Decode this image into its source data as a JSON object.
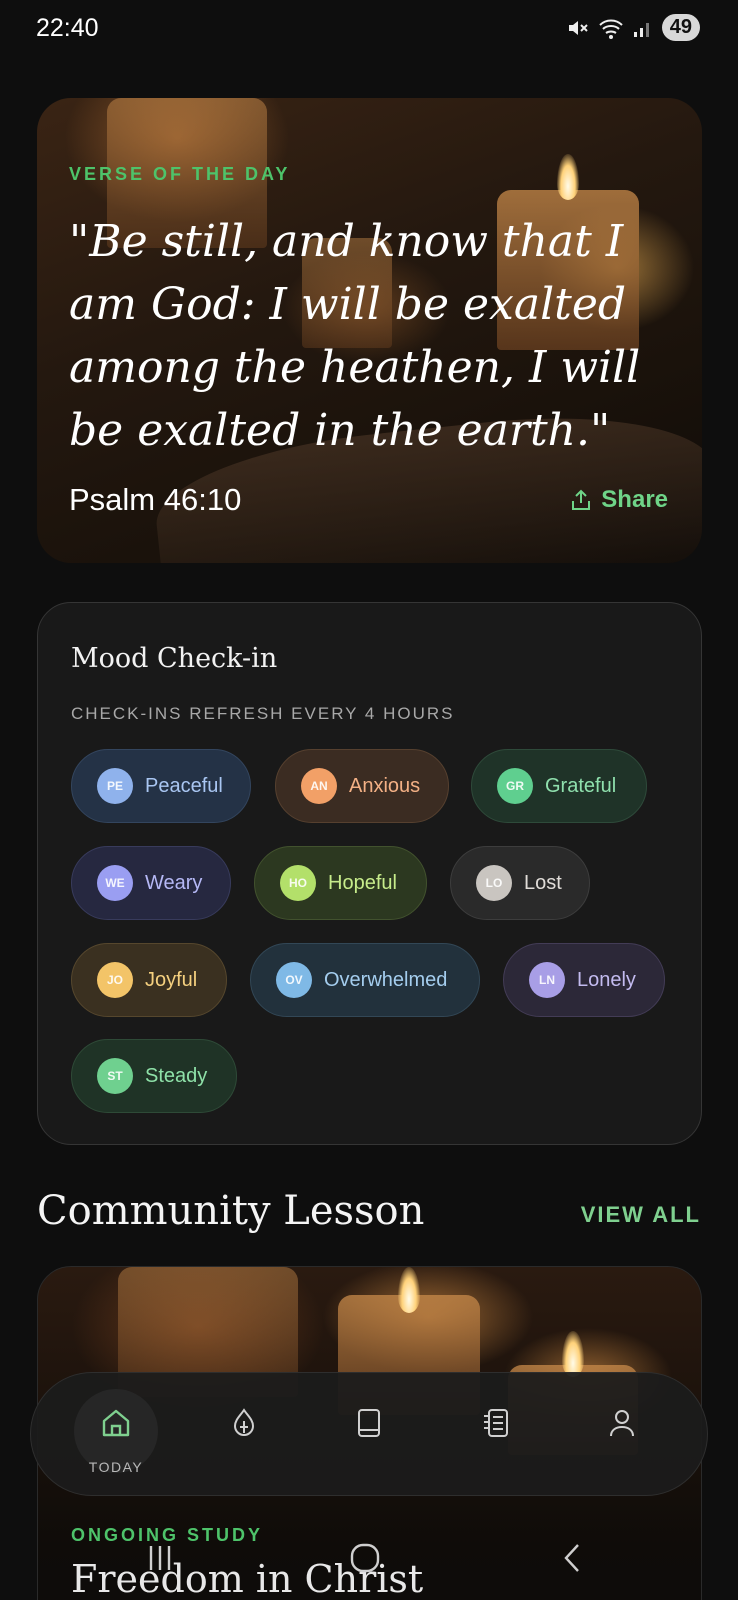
{
  "status_bar": {
    "time": "22:40",
    "battery": "49"
  },
  "verse": {
    "label": "VERSE OF THE DAY",
    "text": "\"Be still, and know that I am God: I will be exalted among the heathen, I will be exalted in the earth.\"",
    "reference": "Psalm 46:10",
    "share_label": "Share"
  },
  "mood": {
    "title": "Mood Check-in",
    "subtitle": "CHECK-INS REFRESH EVERY 4 HOURS",
    "chips": [
      {
        "initials": "PE",
        "label": "Peaceful",
        "bg": "#243246",
        "border": "#33455e",
        "av": "#8fb2ec",
        "text": "#a9c6f2"
      },
      {
        "initials": "AN",
        "label": "Anxious",
        "bg": "#3b2c22",
        "border": "#56402f",
        "av": "#f2a067",
        "text": "#f3b085"
      },
      {
        "initials": "GR",
        "label": "Grateful",
        "bg": "#1f3328",
        "border": "#2e4a3a",
        "av": "#5fcf8f",
        "text": "#8fe0ad"
      },
      {
        "initials": "WE",
        "label": "Weary",
        "bg": "#262840",
        "border": "#383b5c",
        "av": "#9a9ef2",
        "text": "#b5b8f5"
      },
      {
        "initials": "HO",
        "label": "Hopeful",
        "bg": "#2c3820",
        "border": "#42522e",
        "av": "#b3e06a",
        "text": "#c7ec8b"
      },
      {
        "initials": "LO",
        "label": "Lost",
        "bg": "#2a2a2a",
        "border": "#3d3d3d",
        "av": "#c9c5c0",
        "text": "#e0dcd8"
      },
      {
        "initials": "JO",
        "label": "Joyful",
        "bg": "#3a3020",
        "border": "#56472d",
        "av": "#f3c468",
        "text": "#f5d07f"
      },
      {
        "initials": "OV",
        "label": "Overwhelmed",
        "bg": "#22313c",
        "border": "#324756",
        "av": "#7fb9e6",
        "text": "#a4cdee"
      },
      {
        "initials": "LN",
        "label": "Lonely",
        "bg": "#2c2838",
        "border": "#433c56",
        "av": "#a89ee6",
        "text": "#c3bbef"
      },
      {
        "initials": "ST",
        "label": "Steady",
        "bg": "#1f3326",
        "border": "#2e4a37",
        "av": "#6fd08f",
        "text": "#8ee1a8"
      }
    ]
  },
  "community": {
    "title": "Community Lesson",
    "view_all": "VIEW ALL",
    "lesson_label": "ONGOING STUDY",
    "lesson_title": "Freedom in Christ"
  },
  "nav": {
    "items": [
      {
        "name": "home",
        "label": "TODAY",
        "active": true
      },
      {
        "name": "prayer",
        "label": "",
        "active": false
      },
      {
        "name": "bible",
        "label": "",
        "active": false
      },
      {
        "name": "journal",
        "label": "",
        "active": false
      },
      {
        "name": "profile",
        "label": "",
        "active": false
      }
    ]
  },
  "colors": {
    "accent": "#4ec36a",
    "background": "#0e0e0e",
    "card": "#191919"
  }
}
